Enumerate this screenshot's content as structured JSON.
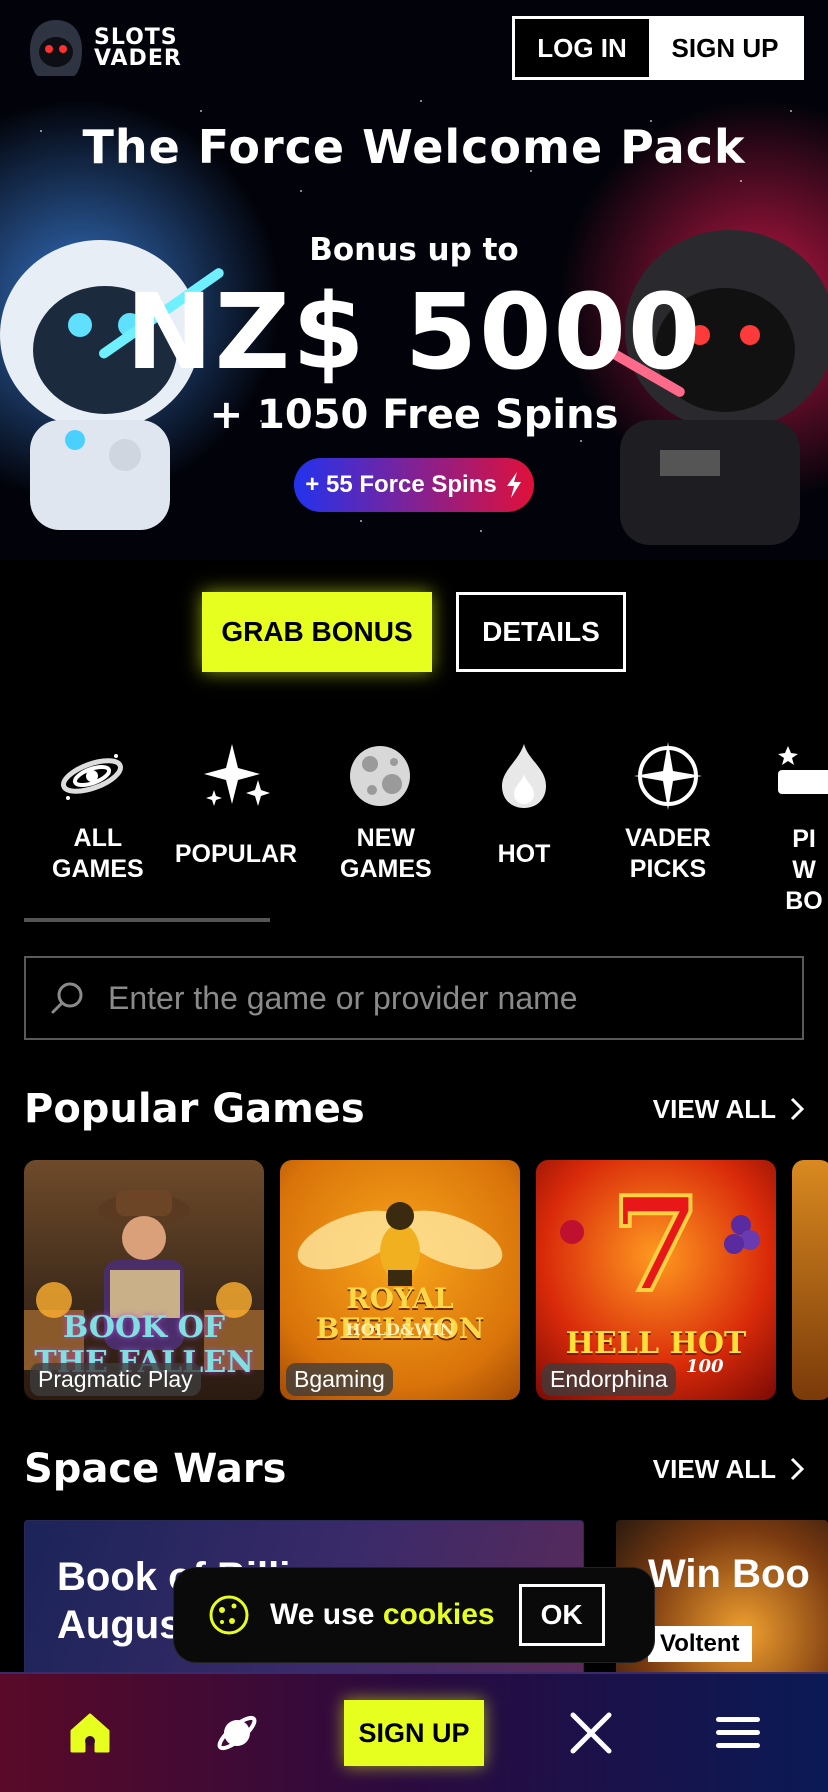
{
  "brand": {
    "line1": "SLOTS",
    "line2": "VADER"
  },
  "header": {
    "login_label": "LOG IN",
    "signup_label": "SIGN UP"
  },
  "hero": {
    "title": "The Force Welcome Pack",
    "bonus_prefix": "Bonus up to",
    "amount": "NZ$ 5000",
    "free_spins": "+ 1050 Free Spins",
    "force_spins": "+ 55 Force Spins"
  },
  "cta": {
    "grab_label": "GRAB BONUS",
    "details_label": "DETAILS"
  },
  "categories": [
    {
      "label": "ALL GAMES",
      "icon": "galaxy-icon"
    },
    {
      "label": "POPULAR",
      "icon": "sparkles-icon"
    },
    {
      "label": "NEW GAMES",
      "icon": "moon-icon"
    },
    {
      "label": "HOT",
      "icon": "flame-icon"
    },
    {
      "label": "VADER PICKS",
      "icon": "compass-star-icon"
    },
    {
      "label": "PI W BO",
      "icon": "bonus-badge-icon"
    }
  ],
  "search": {
    "placeholder": "Enter the game or provider name"
  },
  "popular": {
    "title": "Popular Games",
    "view_all": "VIEW ALL",
    "games": [
      {
        "name": "BOOK OF THE FALLEN",
        "provider": "Pragmatic Play"
      },
      {
        "name": "ROYAL BEELLION",
        "subtitle": "HOLD&WIN",
        "provider": "Bgaming"
      },
      {
        "name": "HELL HOT",
        "subtitle": "100",
        "provider": "Endorphina"
      }
    ]
  },
  "space_wars": {
    "title": "Space Wars",
    "view_all": "VIEW ALL",
    "cards": [
      {
        "title": "Book of Billions: August"
      },
      {
        "title": "Win Boo",
        "provider": "Voltent"
      }
    ]
  },
  "cookie": {
    "text_prefix": "We use",
    "text_highlight": "cookies",
    "ok_label": "OK"
  },
  "bottom_nav": {
    "signup_label": "SIGN UP"
  },
  "colors": {
    "accent": "#e6ff1e",
    "background": "#000000"
  }
}
